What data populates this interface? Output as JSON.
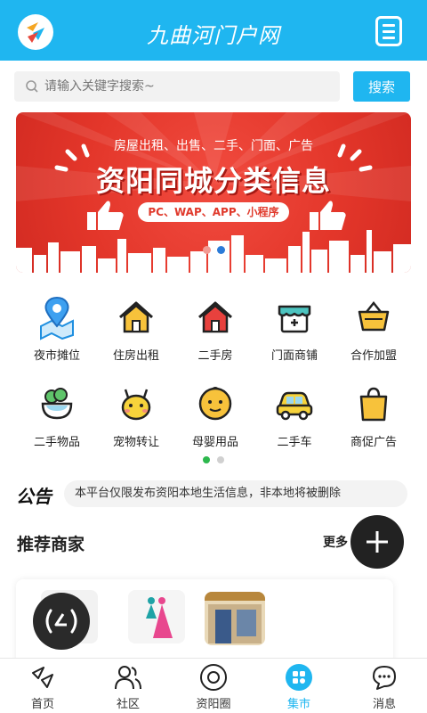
{
  "header": {
    "title": "九曲河门户网"
  },
  "search": {
    "placeholder": "请输入关键字搜索~",
    "button_label": "搜索"
  },
  "banner": {
    "subtitle": "房屋出租、出售、二手、门面、广告",
    "headline": "资阳同城分类信息",
    "platforms": "PC、WAP、APP、小程序"
  },
  "categories": [
    {
      "label": "夜市摊位",
      "icon": "map-pin-icon"
    },
    {
      "label": "住房出租",
      "icon": "house-icon"
    },
    {
      "label": "二手房",
      "icon": "house-red-icon"
    },
    {
      "label": "门面商铺",
      "icon": "store-icon"
    },
    {
      "label": "合作加盟",
      "icon": "basket-icon"
    },
    {
      "label": "二手物品",
      "icon": "bowl-icon"
    },
    {
      "label": "宠物转让",
      "icon": "pet-icon"
    },
    {
      "label": "母婴用品",
      "icon": "baby-icon"
    },
    {
      "label": "二手车",
      "icon": "car-icon"
    },
    {
      "label": "商促广告",
      "icon": "shopping-bag-icon"
    }
  ],
  "notice": {
    "logo_text": "公告",
    "text": "本平台仅限发布资阳本地生活信息，非本地将被删除"
  },
  "recommend": {
    "title": "推荐商家",
    "more_label": "更多"
  },
  "bottom_nav": [
    {
      "label": "首页",
      "icon": "home-icon",
      "active": false
    },
    {
      "label": "社区",
      "icon": "community-icon",
      "active": false
    },
    {
      "label": "资阳圈",
      "icon": "circle-icon",
      "active": false
    },
    {
      "label": "集市",
      "icon": "market-icon",
      "active": true
    },
    {
      "label": "消息",
      "icon": "message-icon",
      "active": false
    }
  ],
  "colors": {
    "brand": "#1fb6f0",
    "banner_red": "#e3362a",
    "active_dot": "#2db84d"
  }
}
